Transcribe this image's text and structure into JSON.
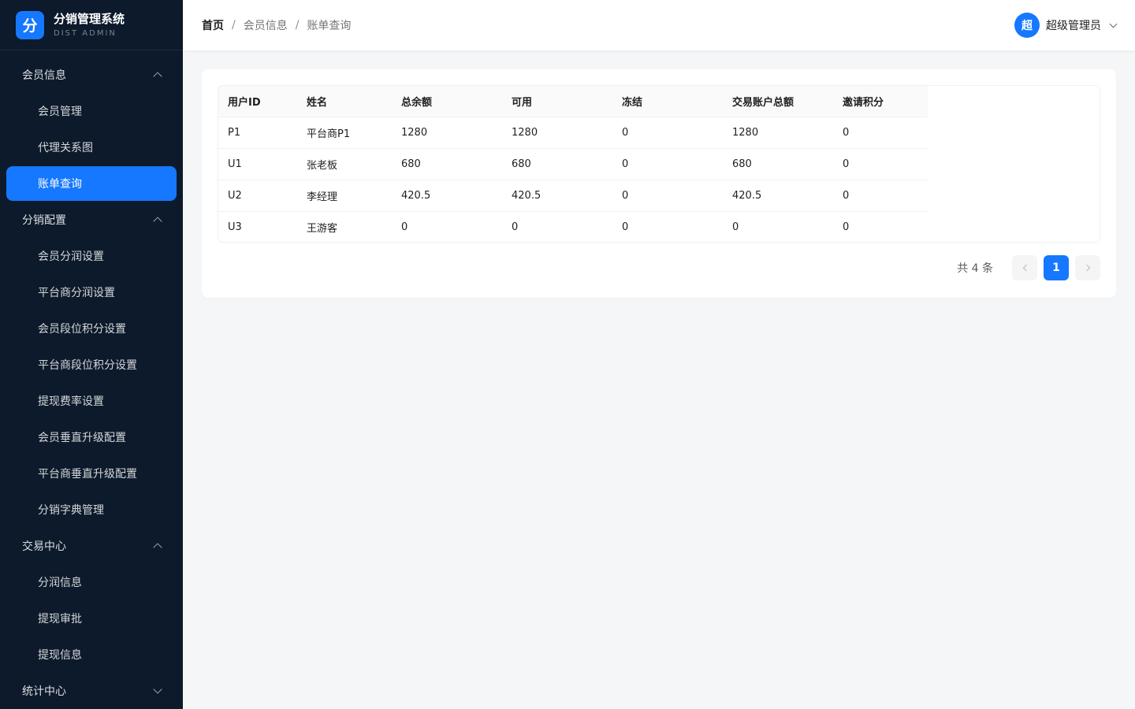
{
  "brand": {
    "logo_char": "分",
    "title": "分销管理系统",
    "subtitle": "DIST ADMIN"
  },
  "sidebar": {
    "groups": [
      {
        "label": "会员信息",
        "expanded": true,
        "items": [
          "会员管理",
          "代理关系图",
          "账单查询"
        ]
      },
      {
        "label": "分销配置",
        "expanded": true,
        "items": [
          "会员分润设置",
          "平台商分润设置",
          "会员段位积分设置",
          "平台商段位积分设置",
          "提现费率设置",
          "会员垂直升级配置",
          "平台商垂直升级配置",
          "分销字典管理"
        ]
      },
      {
        "label": "交易中心",
        "expanded": true,
        "items": [
          "分润信息",
          "提现审批",
          "提现信息"
        ]
      },
      {
        "label": "统计中心",
        "expanded": false,
        "items": []
      }
    ],
    "active_item": "账单查询"
  },
  "header": {
    "breadcrumb": [
      "首页",
      "会员信息",
      "账单查询"
    ],
    "separator": "/",
    "user": {
      "avatar_char": "超",
      "name": "超级管理员"
    }
  },
  "table": {
    "columns": [
      "用户ID",
      "姓名",
      "总余额",
      "可用",
      "冻结",
      "交易账户总额",
      "邀请积分"
    ],
    "rows": [
      [
        "P1",
        "平台商P1",
        "1280",
        "1280",
        "0",
        "1280",
        "0"
      ],
      [
        "U1",
        "张老板",
        "680",
        "680",
        "0",
        "680",
        "0"
      ],
      [
        "U2",
        "李经理",
        "420.5",
        "420.5",
        "0",
        "420.5",
        "0"
      ],
      [
        "U3",
        "王游客",
        "0",
        "0",
        "0",
        "0",
        "0"
      ]
    ]
  },
  "pagination": {
    "total_text": "共 4 条",
    "current_page": "1"
  },
  "colors": {
    "sidebar_bg": "#0c1a2b",
    "accent": "#1677ff",
    "page_bg": "#f5f6f8"
  }
}
